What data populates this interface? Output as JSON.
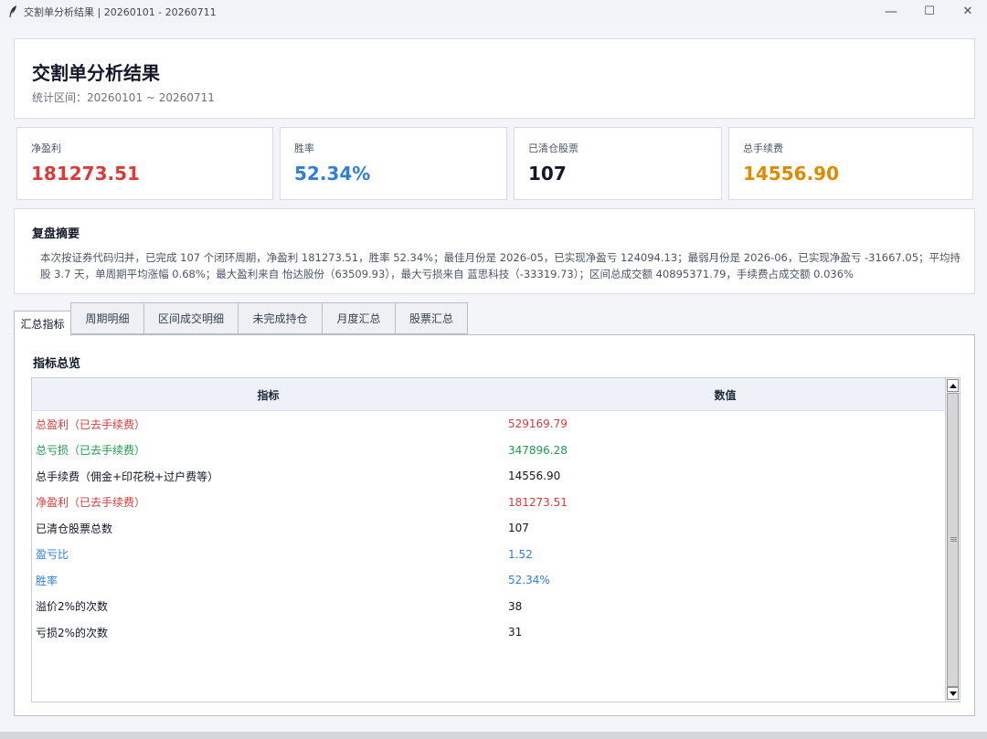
{
  "window": {
    "title": "交割单分析结果 | 20260101 - 20260711",
    "controls": {
      "minimize": "—",
      "maximize": "☐",
      "close": "✕"
    }
  },
  "header": {
    "title": "交割单分析结果",
    "subtitle": "统计区间：20260101 ~ 20260711"
  },
  "kpis": [
    {
      "label": "净盈利",
      "value": "181273.51",
      "color": "#d93a3a"
    },
    {
      "label": "胜率",
      "value": "52.34%",
      "color": "#2f7fd6"
    },
    {
      "label": "已清仓股票",
      "value": "107",
      "color": "#111827"
    },
    {
      "label": "总手续费",
      "value": "14556.90",
      "color": "#e08a00"
    }
  ],
  "summary": {
    "title": "复盘摘要",
    "text": "本次按证券代码归并，已完成 107 个闭环周期，净盈利 181273.51，胜率 52.34%；最佳月份是 2026-05，已实现净盈亏 124094.13；最弱月份是 2026-06，已实现净盈亏 -31667.05；平均持股 3.7 天，单周期平均涨幅 0.68%；最大盈利来自 怡达股份（63509.93），最大亏损来自 蓝思科技（-33319.73）；区间总成交额 40895371.79，手续费占成交额 0.036%"
  },
  "tabs": [
    {
      "label": "汇总指标",
      "active": true
    },
    {
      "label": "周期明细",
      "active": false
    },
    {
      "label": "区间成交明细",
      "active": false
    },
    {
      "label": "未完成持仓",
      "active": false
    },
    {
      "label": "月度汇总",
      "active": false
    },
    {
      "label": "股票汇总",
      "active": false
    }
  ],
  "overview": {
    "title": "指标总览",
    "columns": [
      "指标",
      "数值"
    ],
    "rows": [
      {
        "name": "总盈利（已去手续费）",
        "value": "529169.79",
        "color": "#d93a3a"
      },
      {
        "name": "总亏损（已去手续费）",
        "value": "347896.28",
        "color": "#1e9a4a"
      },
      {
        "name": "总手续费（佣金+印花税+过户费等）",
        "value": "14556.90",
        "color": "#111827"
      },
      {
        "name": "净盈利（已去手续费）",
        "value": "181273.51",
        "color": "#d93a3a"
      },
      {
        "name": "已清仓股票总数",
        "value": "107",
        "color": "#111827"
      },
      {
        "name": "盈亏比",
        "value": "1.52",
        "color": "#2f7fd6"
      },
      {
        "name": "胜率",
        "value": "52.34%",
        "color": "#2f7fd6"
      },
      {
        "name": "溢价2%的次数",
        "value": "38",
        "color": "#111827"
      },
      {
        "name": "亏损2%的次数",
        "value": "31",
        "color": "#111827"
      }
    ]
  },
  "colors": {
    "profit": "#d93a3a",
    "loss": "#1e9a4a",
    "accent": "#2f7fd6",
    "fee": "#e08a00"
  }
}
